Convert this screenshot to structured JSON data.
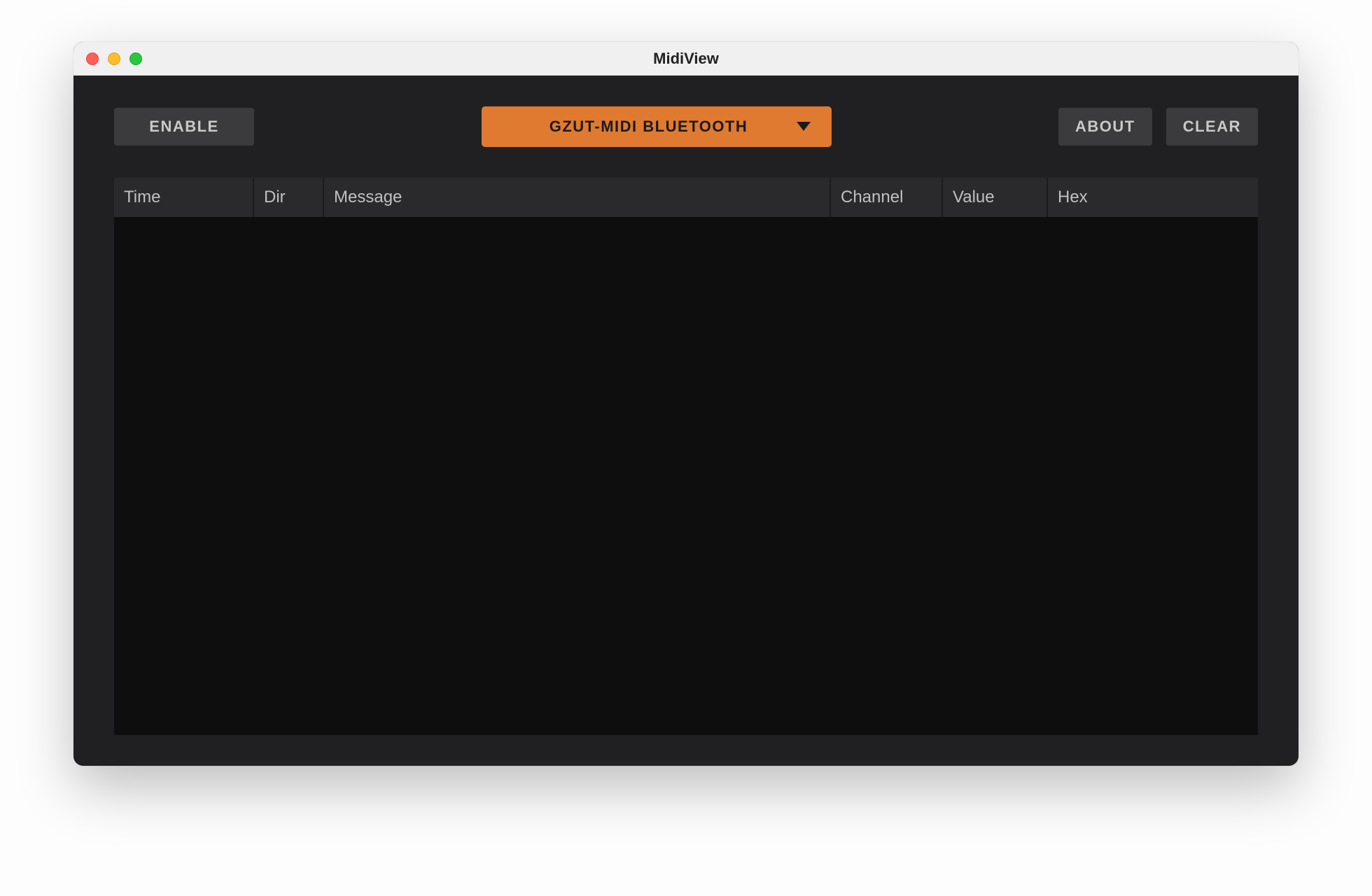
{
  "window": {
    "title": "MidiView"
  },
  "toolbar": {
    "enable_label": "ENABLE",
    "device_selected": "GZUT-MIDI BLUETOOTH",
    "about_label": "ABOUT",
    "clear_label": "CLEAR"
  },
  "table": {
    "columns": {
      "time": "Time",
      "dir": "Dir",
      "message": "Message",
      "channel": "Channel",
      "value": "Value",
      "hex": "Hex"
    },
    "rows": []
  },
  "colors": {
    "accent": "#e07a30",
    "bg_dark": "#202022",
    "bg_darker": "#0e0e0f",
    "btn_bg": "#3b3b3d"
  }
}
